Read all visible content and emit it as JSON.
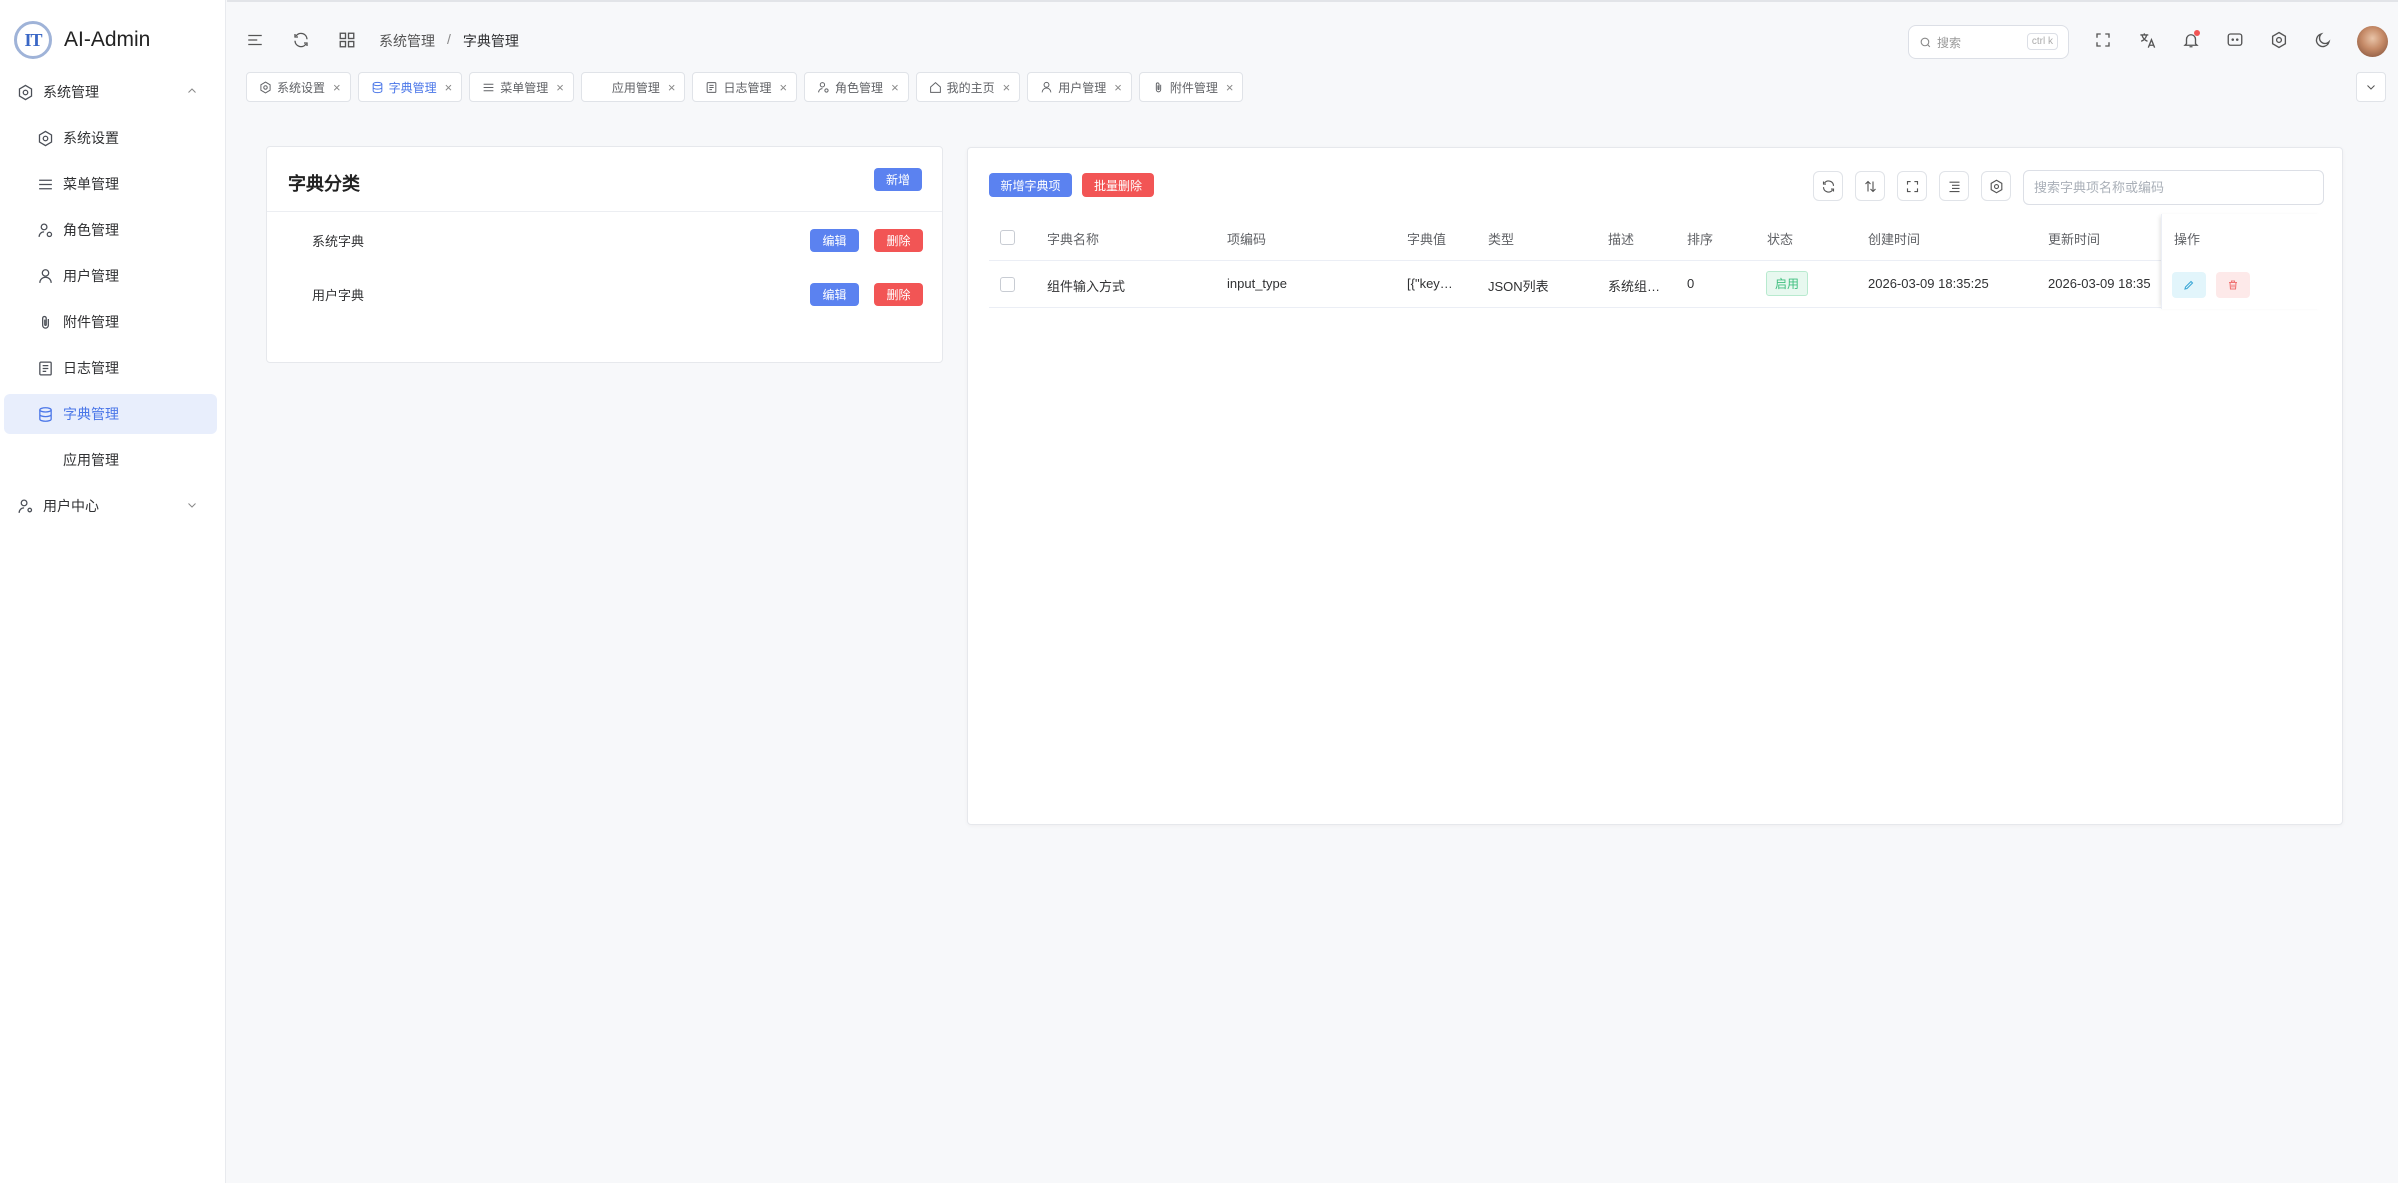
{
  "app": {
    "name": "AI-Admin",
    "logo_text": "IT"
  },
  "sidebar": {
    "groups": [
      {
        "label": "系统管理",
        "icon": "settings-icon",
        "expanded": true
      },
      {
        "label": "用户中心",
        "icon": "user-center-icon",
        "expanded": false
      }
    ],
    "items": [
      {
        "label": "系统设置",
        "icon": "settings-icon"
      },
      {
        "label": "菜单管理",
        "icon": "menu-list-icon"
      },
      {
        "label": "角色管理",
        "icon": "role-icon"
      },
      {
        "label": "用户管理",
        "icon": "user-icon"
      },
      {
        "label": "附件管理",
        "icon": "paperclip-icon"
      },
      {
        "label": "日志管理",
        "icon": "log-icon"
      },
      {
        "label": "字典管理",
        "icon": "database-icon",
        "active": true
      },
      {
        "label": "应用管理",
        "icon": ""
      }
    ]
  },
  "header": {
    "breadcrumb": [
      "系统管理",
      "字典管理"
    ],
    "breadcrumb_sep": "/",
    "search_placeholder": "搜索",
    "search_shortcut": "ctrl k",
    "accent": "#4a76e8"
  },
  "tabs": [
    {
      "label": "系统设置",
      "icon": "settings-icon"
    },
    {
      "label": "字典管理",
      "icon": "database-icon",
      "active": true
    },
    {
      "label": "菜单管理",
      "icon": "menu-list-icon"
    },
    {
      "label": "应用管理",
      "icon": ""
    },
    {
      "label": "日志管理",
      "icon": "log-icon"
    },
    {
      "label": "角色管理",
      "icon": "role-icon"
    },
    {
      "label": "我的主页",
      "icon": "home-icon"
    },
    {
      "label": "用户管理",
      "icon": "user-icon"
    },
    {
      "label": "附件管理",
      "icon": "paperclip-icon"
    }
  ],
  "dict_category": {
    "title": "字典分类",
    "add_label": "新增",
    "edit_label": "编辑",
    "delete_label": "删除",
    "items": [
      "系统字典",
      "用户字典"
    ]
  },
  "dict_items": {
    "add_label": "新增字典项",
    "batch_delete_label": "批量删除",
    "search_placeholder": "搜索字典项名称或编码",
    "columns": [
      "字典名称",
      "项编码",
      "字典值",
      "类型",
      "描述",
      "排序",
      "状态",
      "创建时间",
      "更新时间",
      "操作"
    ],
    "rows": [
      {
        "name": "组件输入方式",
        "code": "input_type",
        "value": "[{\"key…",
        "type": "JSON列表",
        "desc": "系统组…",
        "sort": "0",
        "status": "启用",
        "created": "2026-03-09 18:35:25",
        "updated": "2026-03-09 18:35"
      }
    ]
  },
  "colors": {
    "primary_button": "#5b82f0",
    "danger_button": "#f25555",
    "status_enabled": "#3fbf7f"
  }
}
